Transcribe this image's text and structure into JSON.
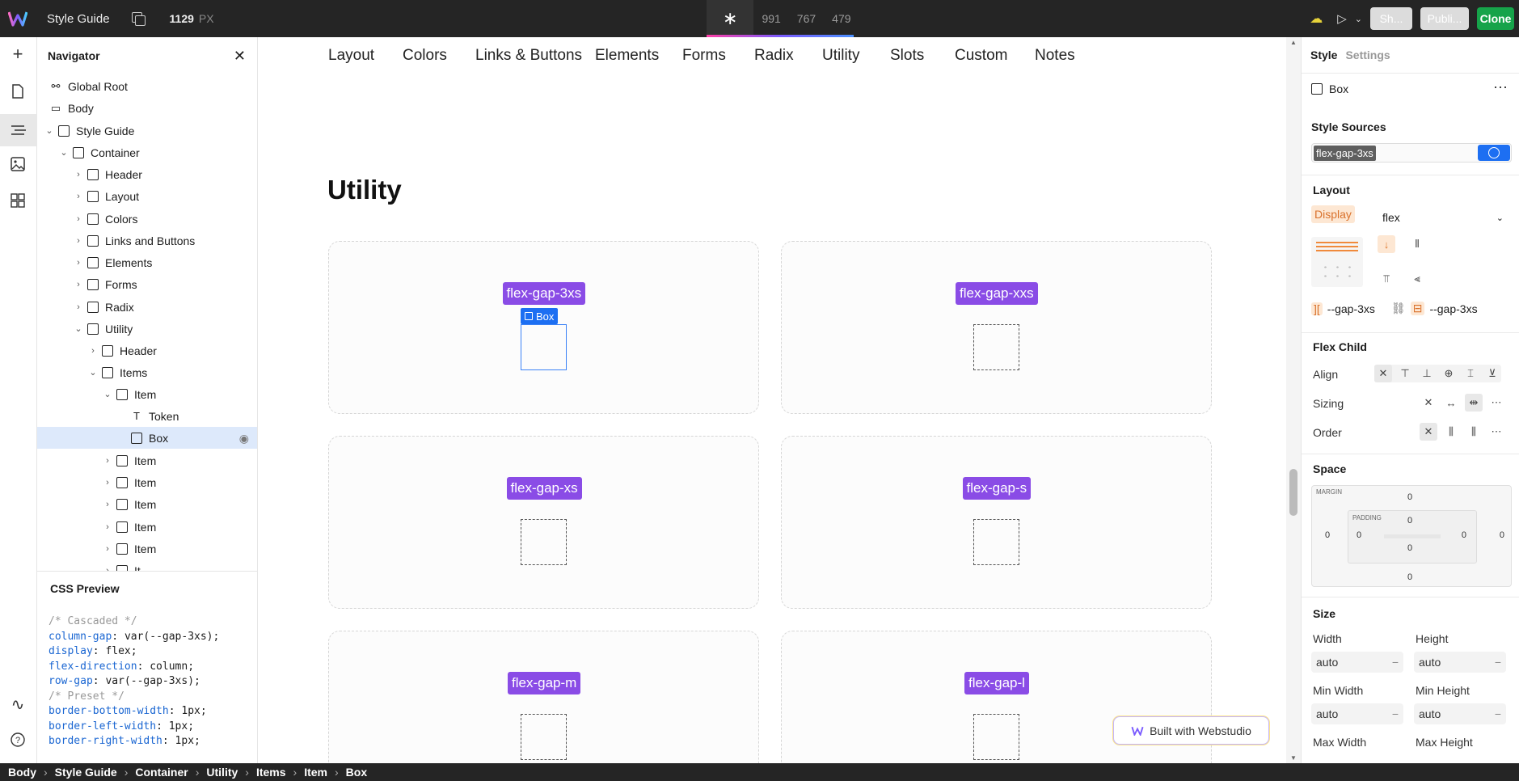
{
  "topbar": {
    "project": "Style Guide",
    "breakpoint_width": "1129",
    "unit": "PX",
    "breakpoints": [
      "991",
      "767",
      "479"
    ],
    "share": "Sh...",
    "publish": "Publi...",
    "clone": "Clone"
  },
  "navigator": {
    "title": "Navigator",
    "items": [
      {
        "label": "Global Root",
        "depth": 0,
        "icon": "globe-icon",
        "chevron": ""
      },
      {
        "label": "Body",
        "depth": 0,
        "icon": "body-icon",
        "chevron": ""
      },
      {
        "label": "Style Guide",
        "depth": 0,
        "icon": "box",
        "chevron": "v"
      },
      {
        "label": "Container",
        "depth": 1,
        "icon": "box",
        "chevron": "v"
      },
      {
        "label": "Header",
        "depth": 2,
        "icon": "box",
        "chevron": ">"
      },
      {
        "label": "Layout",
        "depth": 2,
        "icon": "box",
        "chevron": ">"
      },
      {
        "label": "Colors",
        "depth": 2,
        "icon": "box",
        "chevron": ">"
      },
      {
        "label": "Links and Buttons",
        "depth": 2,
        "icon": "box",
        "chevron": ">"
      },
      {
        "label": "Elements",
        "depth": 2,
        "icon": "box",
        "chevron": ">"
      },
      {
        "label": "Forms",
        "depth": 2,
        "icon": "box",
        "chevron": ">"
      },
      {
        "label": "Radix",
        "depth": 2,
        "icon": "box",
        "chevron": ">"
      },
      {
        "label": "Utility",
        "depth": 2,
        "icon": "box",
        "chevron": "v"
      },
      {
        "label": "Header",
        "depth": 3,
        "icon": "box",
        "chevron": ">"
      },
      {
        "label": "Items",
        "depth": 3,
        "icon": "box",
        "chevron": "v"
      },
      {
        "label": "Item",
        "depth": 4,
        "icon": "box",
        "chevron": "v"
      },
      {
        "label": "Token",
        "depth": 5,
        "icon": "text",
        "chevron": ""
      },
      {
        "label": "Box",
        "depth": 5,
        "icon": "box",
        "chevron": "",
        "selected": true
      },
      {
        "label": "Item",
        "depth": 4,
        "icon": "box",
        "chevron": ">"
      },
      {
        "label": "Item",
        "depth": 4,
        "icon": "box",
        "chevron": ">"
      },
      {
        "label": "Item",
        "depth": 4,
        "icon": "box",
        "chevron": ">"
      },
      {
        "label": "Item",
        "depth": 4,
        "icon": "box",
        "chevron": ">"
      },
      {
        "label": "Item",
        "depth": 4,
        "icon": "box",
        "chevron": ">"
      },
      {
        "label": "It",
        "depth": 4,
        "icon": "box",
        "chevron": ">"
      }
    ]
  },
  "css_preview": {
    "title": "CSS Preview",
    "lines": [
      {
        "k": "comment",
        "t": "/* Cascaded */"
      },
      {
        "k": "decl",
        "p": "column-gap",
        "v": "var(--gap-3xs)"
      },
      {
        "k": "decl",
        "p": "display",
        "v": "flex"
      },
      {
        "k": "decl",
        "p": "flex-direction",
        "v": "column"
      },
      {
        "k": "decl",
        "p": "row-gap",
        "v": "var(--gap-3xs)"
      },
      {
        "k": "comment",
        "t": "/* Preset */"
      },
      {
        "k": "decl",
        "p": "border-bottom-width",
        "v": "1px"
      },
      {
        "k": "decl",
        "p": "border-left-width",
        "v": "1px"
      },
      {
        "k": "decl",
        "p": "border-right-width",
        "v": "1px"
      }
    ]
  },
  "canvas": {
    "nav": [
      "Layout",
      "Colors",
      "Links & Buttons",
      "Elements",
      "Forms",
      "Radix",
      "Utility",
      "Slots",
      "Custom",
      "Notes"
    ],
    "section_title": "Utility",
    "tokens": [
      "flex-gap-3xs",
      "flex-gap-xxs",
      "flex-gap-xs",
      "flex-gap-s",
      "flex-gap-m",
      "flex-gap-l"
    ],
    "selected_badge": "Box",
    "built_with": "Built with Webstudio"
  },
  "style_panel": {
    "tabs": [
      "Style",
      "Settings"
    ],
    "instance": "Box",
    "sources_title": "Style Sources",
    "source_token": "flex-gap-3xs",
    "layout_title": "Layout",
    "display_label": "Display",
    "display_value": "flex",
    "gap_left": "--gap-3xs",
    "gap_right": "--gap-3xs",
    "flex_child_title": "Flex Child",
    "align_label": "Align",
    "sizing_label": "Sizing",
    "order_label": "Order",
    "space_title": "Space",
    "margin_label": "MARGIN",
    "padding_label": "PADDING",
    "margin": {
      "top": "0",
      "right": "0",
      "bottom": "0",
      "left": "0"
    },
    "padding": {
      "top": "0",
      "right": "0",
      "bottom": "0",
      "left": "0"
    },
    "size_title": "Size",
    "width_label": "Width",
    "height_label": "Height",
    "width": "auto",
    "height": "auto",
    "min_width_label": "Min Width",
    "min_height_label": "Min Height",
    "min_width": "auto",
    "min_height": "auto",
    "max_width_label": "Max Width",
    "max_height_label": "Max Height"
  },
  "breadcrumbs": [
    "Body",
    "Style Guide",
    "Container",
    "Utility",
    "Items",
    "Item",
    "Box"
  ],
  "colors": {
    "accent": "#1d6ff2",
    "token": "#8a4ce6",
    "clone": "#16a34a",
    "topbar": "#252525"
  }
}
